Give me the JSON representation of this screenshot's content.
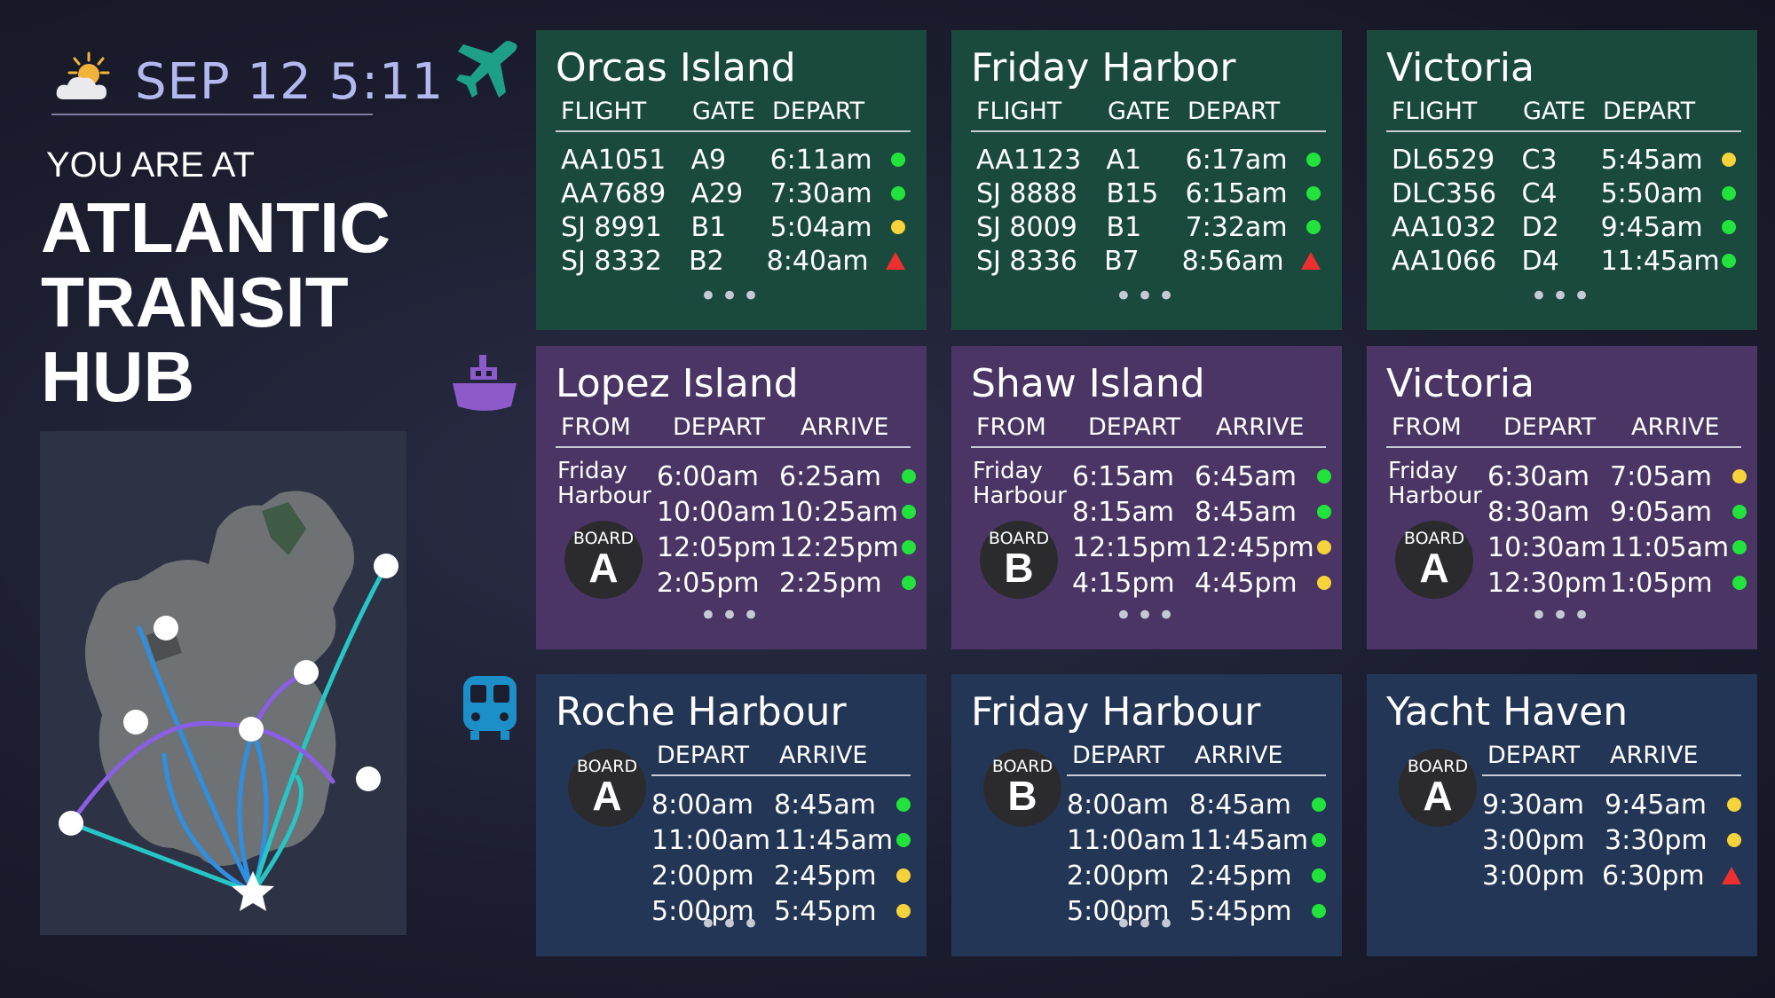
{
  "header": {
    "date": "SEP 12  5:11",
    "you_are_at": "YOU ARE AT",
    "hub_lines": [
      "ATLANTIC",
      "TRANSIT",
      "HUB"
    ]
  },
  "icons": {
    "weather": "partly-cloudy-icon",
    "flight": "airplane-icon",
    "ferry": "ferry-icon",
    "train": "train-icon"
  },
  "colors": {
    "flight_panel": "#1a4a3e",
    "ferry_panel": "#4a3565",
    "train_panel": "#233655",
    "on_time": "#22e33c",
    "delayed": "#f6d23b",
    "alert": "#ef2f2f",
    "icon_green": "#1ea086",
    "icon_purple": "#8c5bc9",
    "icon_blue": "#1d8fc8"
  },
  "more": "•••",
  "flights": {
    "columns": [
      "FLIGHT",
      "GATE",
      "DEPART"
    ],
    "panels": [
      {
        "title": "Orcas Island",
        "rows": [
          {
            "flight": "AA1051",
            "gate": "A9",
            "depart": "6:11am",
            "status": "green"
          },
          {
            "flight": "AA7689",
            "gate": "A29",
            "depart": "7:30am",
            "status": "green"
          },
          {
            "flight": "SJ 8991",
            "gate": "B1",
            "depart": "5:04am",
            "status": "yellow"
          },
          {
            "flight": "SJ 8332",
            "gate": "B2",
            "depart": "8:40am",
            "status": "red"
          }
        ]
      },
      {
        "title": "Friday Harbor",
        "rows": [
          {
            "flight": "AA1123",
            "gate": "A1",
            "depart": "6:17am",
            "status": "green"
          },
          {
            "flight": "SJ 8888",
            "gate": "B15",
            "depart": "6:15am",
            "status": "green"
          },
          {
            "flight": "SJ 8009",
            "gate": "B1",
            "depart": "7:32am",
            "status": "green"
          },
          {
            "flight": "SJ 8336",
            "gate": "B7",
            "depart": "8:56am",
            "status": "red"
          }
        ]
      },
      {
        "title": "Victoria",
        "rows": [
          {
            "flight": "DL6529",
            "gate": "C3",
            "depart": "5:45am",
            "status": "yellow"
          },
          {
            "flight": "DLC356",
            "gate": "C4",
            "depart": "5:50am",
            "status": "green"
          },
          {
            "flight": "AA1032",
            "gate": "D2",
            "depart": "9:45am",
            "status": "green"
          },
          {
            "flight": "AA1066",
            "gate": "D4",
            "depart": "11:45am",
            "status": "green"
          }
        ]
      }
    ]
  },
  "ferries": {
    "columns": [
      "FROM",
      "DEPART",
      "ARRIVE"
    ],
    "board_label": "BOARD",
    "panels": [
      {
        "title": "Lopez Island",
        "from": [
          "Friday",
          "Harbour"
        ],
        "board": "A",
        "rows": [
          {
            "depart": "6:00am",
            "arrive": "6:25am",
            "status": "green"
          },
          {
            "depart": "10:00am",
            "arrive": "10:25am",
            "status": "green"
          },
          {
            "depart": "12:05pm",
            "arrive": "12:25pm",
            "status": "green"
          },
          {
            "depart": "2:05pm",
            "arrive": "2:25pm",
            "status": "green"
          }
        ]
      },
      {
        "title": "Shaw Island",
        "from": [
          "Friday",
          "Harbour"
        ],
        "board": "B",
        "rows": [
          {
            "depart": "6:15am",
            "arrive": "6:45am",
            "status": "green"
          },
          {
            "depart": "8:15am",
            "arrive": "8:45am",
            "status": "green"
          },
          {
            "depart": "12:15pm",
            "arrive": "12:45pm",
            "status": "yellow"
          },
          {
            "depart": "4:15pm",
            "arrive": "4:45pm",
            "status": "yellow"
          }
        ]
      },
      {
        "title": "Victoria",
        "from": [
          "Friday",
          "Harbour"
        ],
        "board": "A",
        "rows": [
          {
            "depart": "6:30am",
            "arrive": "7:05am",
            "status": "yellow"
          },
          {
            "depart": "8:30am",
            "arrive": "9:05am",
            "status": "green"
          },
          {
            "depart": "10:30am",
            "arrive": "11:05am",
            "status": "green"
          },
          {
            "depart": "12:30pm",
            "arrive": "1:05pm",
            "status": "green"
          }
        ]
      }
    ]
  },
  "trains": {
    "columns": [
      "DEPART",
      "ARRIVE"
    ],
    "board_label": "BOARD",
    "panels": [
      {
        "title": "Roche Harbour",
        "board": "A",
        "more": true,
        "rows": [
          {
            "depart": "8:00am",
            "arrive": "8:45am",
            "status": "green"
          },
          {
            "depart": "11:00am",
            "arrive": "11:45am",
            "status": "green"
          },
          {
            "depart": "2:00pm",
            "arrive": "2:45pm",
            "status": "yellow"
          },
          {
            "depart": "5:00pm",
            "arrive": "5:45pm",
            "status": "yellow"
          }
        ]
      },
      {
        "title": "Friday Harbour",
        "board": "B",
        "more": true,
        "rows": [
          {
            "depart": "8:00am",
            "arrive": "8:45am",
            "status": "green"
          },
          {
            "depart": "11:00am",
            "arrive": "11:45am",
            "status": "green"
          },
          {
            "depart": "2:00pm",
            "arrive": "2:45pm",
            "status": "green"
          },
          {
            "depart": "5:00pm",
            "arrive": "5:45pm",
            "status": "green"
          }
        ]
      },
      {
        "title": "Yacht Haven",
        "board": "A",
        "more": false,
        "rows": [
          {
            "depart": "9:30am",
            "arrive": "9:45am",
            "status": "yellow"
          },
          {
            "depart": "3:00pm",
            "arrive": "3:30pm",
            "status": "yellow"
          },
          {
            "depart": "3:00pm",
            "arrive": "6:30pm",
            "status": "red"
          }
        ]
      }
    ]
  }
}
